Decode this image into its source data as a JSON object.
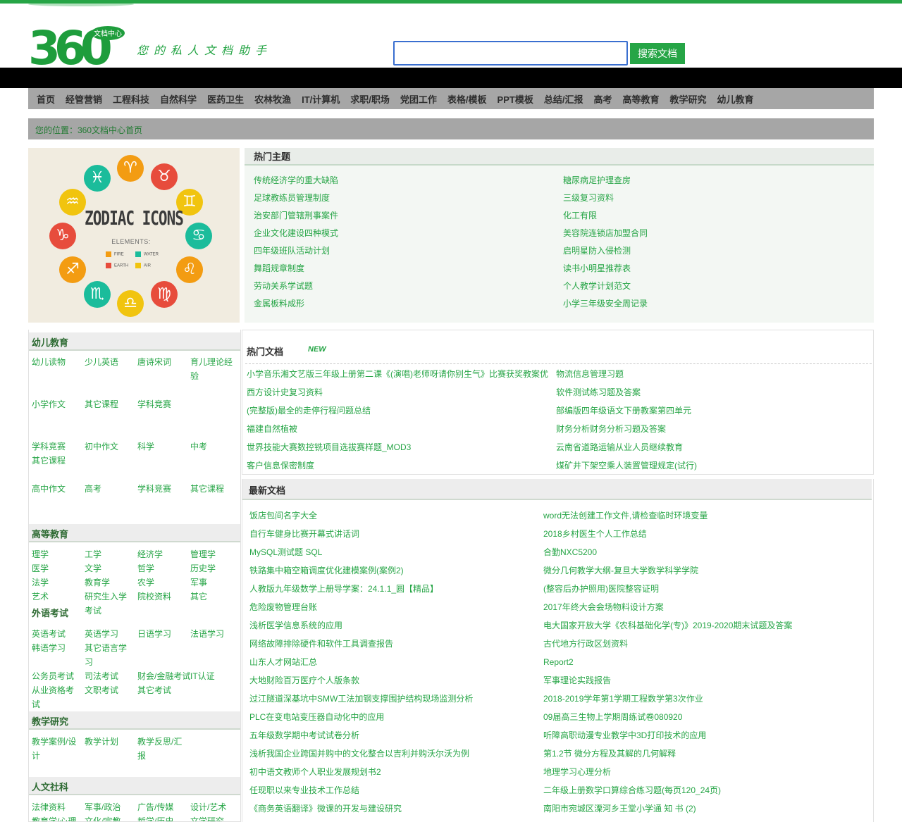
{
  "header": {
    "logo_text": "360",
    "logo_badge": "文档中心",
    "slogan": "您的私人文档助手",
    "search_placeholder": "",
    "search_button": "搜索文档"
  },
  "nav": [
    "首页",
    "经管营销",
    "工程科技",
    "自然科学",
    "医药卫生",
    "农林牧渔",
    "IT/计算机",
    "求职/职场",
    "党团工作",
    "表格/模板",
    "PPT模板",
    "总结/汇报",
    "高考",
    "高等教育",
    "教学研究",
    "幼儿教育"
  ],
  "breadcrumb": "您的位置：360文档中心首页",
  "banner": {
    "title": "ZODIAC ICONS",
    "elements_label": "ELEMENTS:",
    "legend": [
      "FIRE",
      "WATER",
      "EARTH",
      "AIR"
    ],
    "colors": {
      "fire": "#f39c12",
      "water": "#1bbc9b",
      "earth": "#e74c3c",
      "air": "#f1c40f"
    }
  },
  "hot_topics": {
    "title": "热门主题",
    "items": [
      "传统经济学的重大缺陷",
      "糖尿病足护理查房",
      "足球教练员管理制度",
      "三级复习资料",
      "治安部门管辖刑事案件",
      "化工有限",
      "企业文化建设四种模式",
      "美容院连锁店加盟合同",
      "四年级班队活动计划",
      "启明星防入侵检测",
      "舞蹈规章制度",
      "读书小明星推荐表",
      "劳动关系学试题",
      "个人教学计划范文",
      "金属板料成形",
      "小学三年级安全周记录"
    ]
  },
  "sidebar": {
    "cats": [
      {
        "title": "幼儿教育",
        "links": [
          "幼儿读物",
          "少儿英语",
          "唐诗宋词",
          "育儿理论经验",
          "小学作文",
          "其它课程",
          "学科竞赛",
          "学科竞赛其它课程",
          "初中作文",
          "科学",
          "中考",
          "高中作文",
          "高考",
          "学科竞赛",
          "其它课程"
        ]
      },
      {
        "title": "高等教育",
        "links": [
          "理学",
          "工学",
          "经济学",
          "管理学",
          "医学",
          "文学",
          "哲学",
          "历史学",
          "法学",
          "教育学",
          "农学",
          "军事",
          "艺术",
          "研究生入学考试",
          "院校资料",
          "其它"
        ]
      },
      {
        "title": "外语考试",
        "links": [
          "英语考试",
          "英语学习",
          "日语学习",
          "法语学习",
          "韩语学习",
          "其它语言学习",
          "公务员考试",
          "司法考试",
          "财会/金融考试",
          "IT认证",
          "从业资格考试",
          "文职考试",
          "其它考试"
        ]
      },
      {
        "title": "教学研究",
        "links": [
          "教学案例/设计",
          "教学计划",
          "教学反思/汇报"
        ]
      },
      {
        "title": "人文社科",
        "links": [
          "法律资料",
          "军事/政治",
          "广告/传媒",
          "设计/艺术",
          "教育学/心理",
          "文化/宗教",
          "哲学/历史",
          "文学研究"
        ]
      }
    ]
  },
  "hot_docs": {
    "title": "热门文档",
    "badge": "NEW",
    "items": [
      "小学音乐湘文艺版三年级上册第二课《(演唱)老师呀请你别生气》比赛获奖教案优",
      "物流信息管理习题",
      "西方设计史复习资料",
      "软件测试练习题及答案",
      "(完整版)最全的走停行程问题总结",
      "部编版四年级语文下册教案第四单元",
      "福建自然植被",
      "财务分析财务分析习题及答案",
      "世界技能大赛数控铣项目选拔赛样题_MOD3",
      "云南省道路运输从业人员继续教育",
      "客户信息保密制度",
      "煤矿井下架空乘人装置管理规定(试行)"
    ]
  },
  "new_docs": {
    "title": "最新文档",
    "items": [
      "饭店包间名字大全",
      "word无法创建工作文件,请检查临时环境变量",
      "自行车健身比赛开幕式讲话词",
      "2018乡村医生个人工作总结",
      "MySQL测试题 SQL",
      "合勤NXC5200",
      "铁路集中箱空箱调度优化建模案例(案例2)",
      "微分几何教学大纲-复旦大学数学科学学院",
      "人教版九年级数学上册导学案：24.1.1_圆【精品】",
      "(整容后办护照用)医院整容证明",
      "危险废物管理台账",
      "2017年终大会会场物料设计方案",
      "浅析医学信息系统的应用",
      "电大国家开放大学《农科基础化学(专)》2019-2020期末试题及答案",
      "网络故障排除硬件和软件工具调查报告",
      "古代地方行政区划资料",
      "山东人才网站汇总",
      "Report2",
      "大地财险百万医疗个人版条款",
      "军事理论实践报告",
      "过江隧道深基坑中SMW工法加钢支撑围护结构现场监测分析",
      "2018-2019学年第1学期工程数学第3次作业",
      "PLC在变电站变压器自动化中的应用",
      "09届高三生物上学期周练试卷080920",
      "五年级数学期中考试试卷分析",
      "听障高职动漫专业教学中3D打印技术的应用",
      "浅析我国企业跨国并购中的文化整合以吉利并购沃尔沃为例",
      "第1.2节 微分方程及其解的几何解释",
      "初中语文教师个人职业发展规划书2",
      "地理学习心理分析",
      "任现职以来专业技术工作总结",
      "二年级上册数学口算综合练习题(每页120_24页)",
      "《商务英语翻译》微课的开发与建设研究",
      "南阳市宛城区溧河乡王堂小学通 知 书 (2)"
    ]
  }
}
